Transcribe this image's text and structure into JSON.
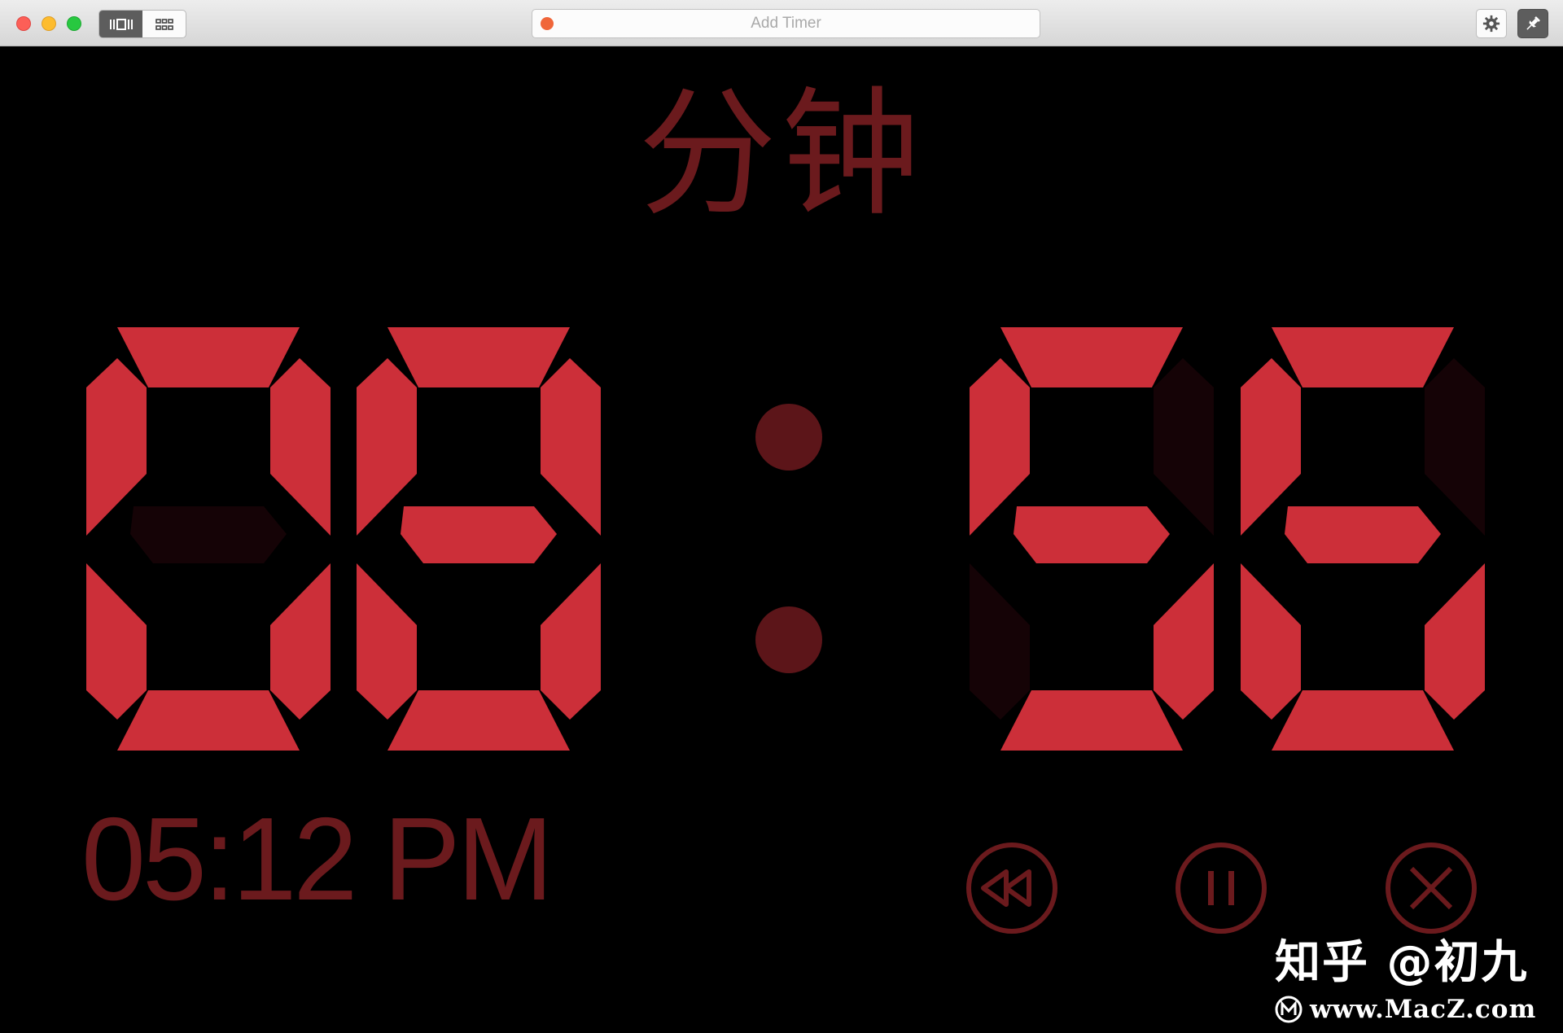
{
  "titlebar": {
    "search_placeholder": "Add Timer",
    "view_modes": [
      "carousel-view",
      "grid-view"
    ],
    "active_view": "carousel-view",
    "icons": {
      "settings": "gear-icon",
      "pin": "pin-icon"
    }
  },
  "timer": {
    "unit_label": "分钟",
    "minutes": "08",
    "seconds": "56",
    "segment_on_color": "#cc2f39",
    "segment_off_color": "#150306",
    "colon_color": "#5c1519"
  },
  "clock": {
    "time": "05:12 PM"
  },
  "controls": [
    {
      "name": "rewind-button",
      "icon": "rewind-icon"
    },
    {
      "name": "pause-button",
      "icon": "pause-icon"
    },
    {
      "name": "close-button",
      "icon": "close-icon"
    }
  ],
  "watermark": {
    "line1": "知乎 @初九",
    "line2": "www.MacZ.com"
  }
}
